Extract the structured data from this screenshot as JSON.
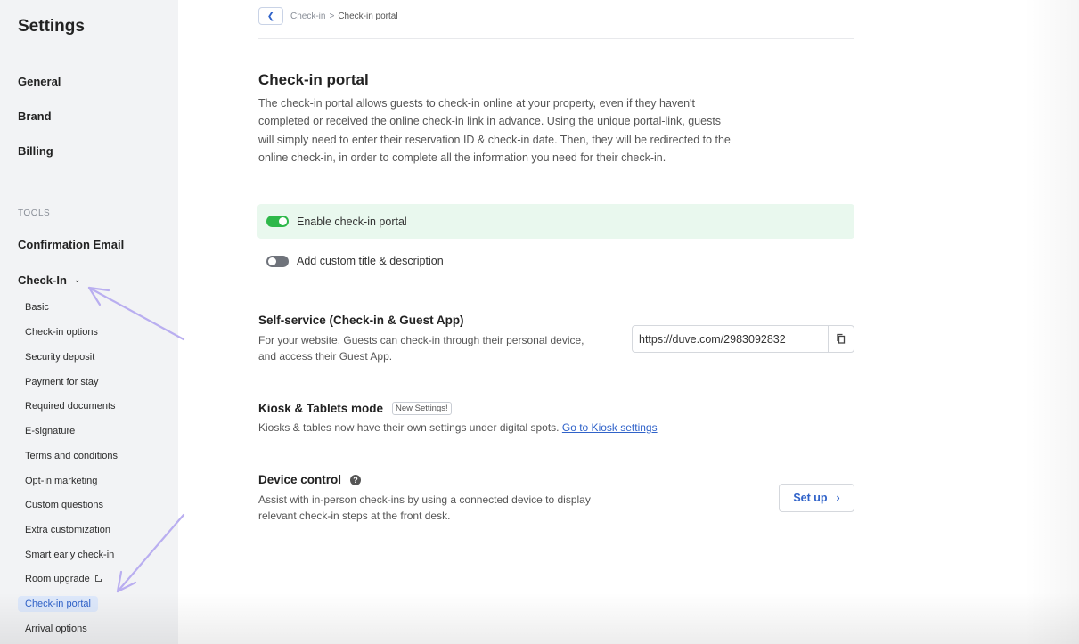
{
  "sidebar": {
    "title": "Settings",
    "main_items": [
      "General",
      "Brand",
      "Billing"
    ],
    "tools_label": "TOOLS",
    "confirmation_email": "Confirmation Email",
    "checkin_label": "Check-In",
    "checkin_items": [
      "Basic",
      "Check-in options",
      "Security deposit",
      "Payment for stay",
      "Required documents",
      "E-signature",
      "Terms and conditions",
      "Opt-in marketing",
      "Custom questions",
      "Extra customization",
      "Smart early check-in",
      "Room upgrade",
      "Check-in portal",
      "Arrival options"
    ],
    "active_item": "Check-in portal"
  },
  "breadcrumb": {
    "parent": "Check-in",
    "separator": ">",
    "current": "Check-in portal"
  },
  "page": {
    "title": "Check-in portal",
    "description": "The check-in portal allows guests to check-in online at your property, even if they haven't completed or received the online check-in link in advance. Using the unique portal-link, guests will simply need to enter their reservation ID & check-in date. Then, they will be redirected to the online check-in,  in order to complete all the information you need for their check-in."
  },
  "toggles": {
    "enable_portal": {
      "label": "Enable check-in portal",
      "state": "on"
    },
    "custom_title": {
      "label": "Add custom title & description",
      "state": "off"
    }
  },
  "self_service": {
    "title": "Self-service (Check-in & Guest App)",
    "text": "For your website. Guests can check-in through their personal device, and access their Guest App.",
    "url": "https://duve.com/2983092832"
  },
  "kiosk": {
    "title": "Kiosk & Tablets mode",
    "badge": "New Settings!",
    "text": "Kiosks & tables now have their own settings under digital spots.",
    "link": "Go to Kiosk settings"
  },
  "device_control": {
    "title": "Device control",
    "text": "Assist with in-person check-ins by using a connected device to display relevant check-in steps at the front desk.",
    "button": "Set up"
  },
  "colors": {
    "accent": "#2f62c9",
    "toggle_on": "#2eb84a",
    "toggle_off": "#6f737b",
    "enable_bg": "#e9f8ee",
    "active_nav_bg": "#dde8fb",
    "arrow": "#b9aef0"
  }
}
